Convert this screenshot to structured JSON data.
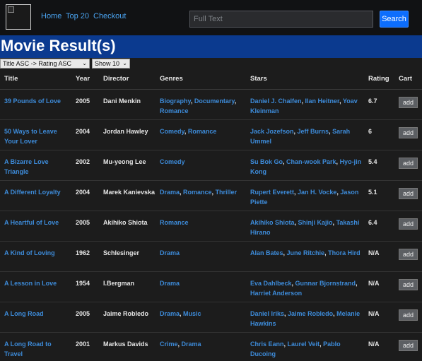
{
  "nav": {
    "links": [
      "Home",
      "Top 20",
      "Checkout"
    ],
    "search_placeholder": "Full Text",
    "search_button": "Search"
  },
  "page_title": "Movie Result(s)",
  "controls": {
    "sort_selected": "Title ASC -> Rating ASC",
    "show_selected": "Show 10"
  },
  "table": {
    "headers": [
      "Title",
      "Year",
      "Director",
      "Genres",
      "Stars",
      "Rating",
      "Cart"
    ],
    "add_label": "add",
    "rows": [
      {
        "title": "39 Pounds of Love",
        "year": "2005",
        "director": "Dani Menkin",
        "genres": [
          "Biography",
          "Documentary",
          "Romance"
        ],
        "stars": [
          "Daniel J. Chalfen",
          "Ilan Heitner",
          "Yoav Kleinman"
        ],
        "rating": "6.7"
      },
      {
        "title": "50 Ways to Leave Your Lover",
        "year": "2004",
        "director": "Jordan Hawley",
        "genres": [
          "Comedy",
          "Romance"
        ],
        "stars": [
          "Jack Jozefson",
          "Jeff Burns",
          "Sarah Ummel"
        ],
        "rating": "6"
      },
      {
        "title": "A Bizarre Love Triangle",
        "year": "2002",
        "director": "Mu-yeong Lee",
        "genres": [
          "Comedy"
        ],
        "stars": [
          "Su Bok Go",
          "Chan-wook Park",
          "Hyo-jin Kong"
        ],
        "rating": "5.4"
      },
      {
        "title": "A Different Loyalty",
        "year": "2004",
        "director": "Marek Kanievska",
        "genres": [
          "Drama",
          "Romance",
          "Thriller"
        ],
        "stars": [
          "Rupert Everett",
          "Jan H. Vocke",
          "Jason Piette"
        ],
        "rating": "5.1"
      },
      {
        "title": "A Heartful of Love",
        "year": "2005",
        "director": "Akihiko Shiota",
        "genres": [
          "Romance"
        ],
        "stars": [
          "Akihiko Shiota",
          "Shinji Kajio",
          "Takashi Hirano"
        ],
        "rating": "6.4"
      },
      {
        "title": "A Kind of Loving",
        "year": "1962",
        "director": "Schlesinger",
        "genres": [
          "Drama"
        ],
        "stars": [
          "Alan Bates",
          "June Ritchie",
          "Thora Hird"
        ],
        "rating": "N/A"
      },
      {
        "title": "A Lesson in Love",
        "year": "1954",
        "director": "I.Bergman",
        "genres": [
          "Drama"
        ],
        "stars": [
          "Eva Dahlbeck",
          "Gunnar Bjornstrand",
          "Harriet Anderson"
        ],
        "rating": "N/A"
      },
      {
        "title": "A Long Road",
        "year": "2005",
        "director": "Jaime Robledo",
        "genres": [
          "Drama",
          "Music"
        ],
        "stars": [
          "Daniel Iriks",
          "Jaime Robledo",
          "Melanie Hawkins"
        ],
        "rating": "N/A"
      },
      {
        "title": "A Long Road to Travel",
        "year": "2001",
        "director": "Markus Davids",
        "genres": [
          "Crime",
          "Drama"
        ],
        "stars": [
          "Chris Eann",
          "Laurel Veit",
          "Pablo Ducoing"
        ],
        "rating": "N/A"
      }
    ]
  }
}
